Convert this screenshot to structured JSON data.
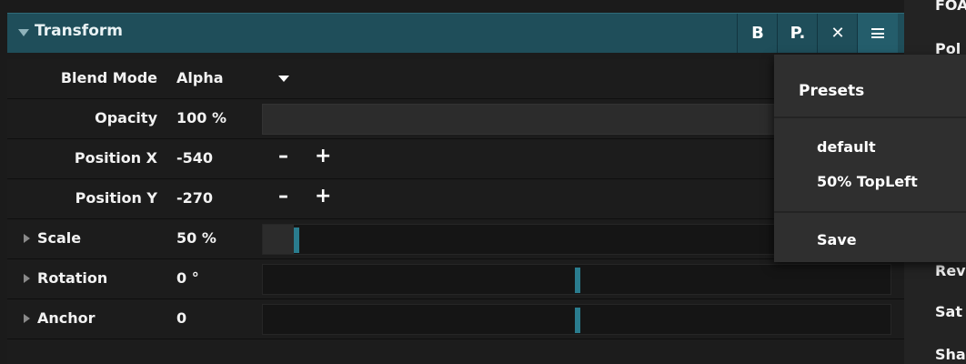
{
  "header": {
    "title": "Transform",
    "bypass_label": "B",
    "preset_label": "P.",
    "close_label": "✕"
  },
  "rows": [
    {
      "label": "Blend Mode",
      "value": "Alpha"
    },
    {
      "label": "Opacity",
      "value": "100 %"
    },
    {
      "label": "Position X",
      "value": "-540",
      "dec": "–",
      "inc": "+"
    },
    {
      "label": "Position Y",
      "value": "-270",
      "dec": "–",
      "inc": "+"
    },
    {
      "label": "Scale",
      "value": "50 %"
    },
    {
      "label": "Rotation",
      "value": "0 °"
    },
    {
      "label": "Anchor",
      "value": "0"
    }
  ],
  "presets_menu": {
    "title": "Presets",
    "items": [
      "default",
      "50% TopLeft"
    ],
    "save_label": "Save"
  },
  "side_panel": {
    "items": [
      "FOA",
      "Pol",
      "Rev",
      "Sat",
      "Sha"
    ]
  }
}
